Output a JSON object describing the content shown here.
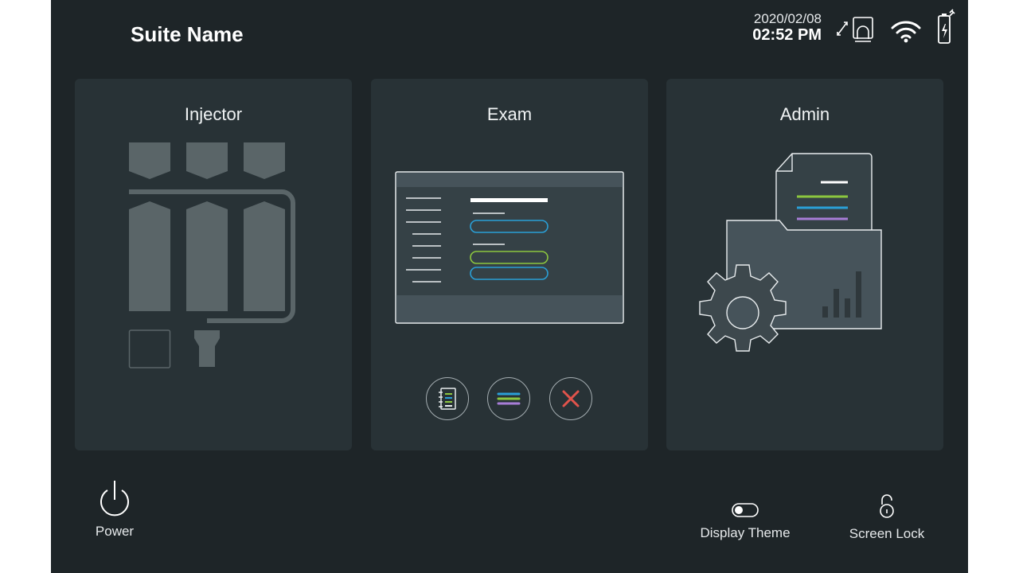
{
  "header": {
    "suite_name": "Suite Name",
    "date": "2020/02/08",
    "time": "02:52 PM",
    "icons": [
      "sync-display-icon",
      "wifi-icon",
      "battery-charging-icon"
    ]
  },
  "cards": [
    {
      "id": "injector",
      "title": "Injector",
      "icon": "injector-syringes-illustration"
    },
    {
      "id": "exam",
      "title": "Exam",
      "icon": "exam-screen-illustration",
      "buttons": [
        {
          "id": "protocol",
          "icon": "notebook-list-icon"
        },
        {
          "id": "menu",
          "icon": "colored-lines-menu-icon"
        },
        {
          "id": "close",
          "icon": "close-x-icon"
        }
      ]
    },
    {
      "id": "admin",
      "title": "Admin",
      "icon": "admin-folder-gear-illustration"
    }
  ],
  "footer": {
    "power_label": "Power",
    "display_theme_label": "Display Theme",
    "screen_lock_label": "Screen Lock"
  },
  "colors": {
    "background": "#1e2528",
    "card": "#283236",
    "accent_green": "#8cc63f",
    "accent_blue": "#2a9fd6",
    "accent_purple": "#a77dd6",
    "close_red": "#e0534b"
  }
}
